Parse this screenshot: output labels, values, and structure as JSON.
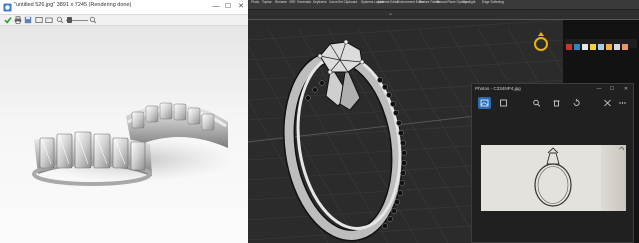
{
  "render_window": {
    "title": "\"untitled 526.jpg\" 3891 x 7245 (Rendering done)",
    "controls": {
      "minimize": "—",
      "maximize": "☐",
      "close": "✕"
    },
    "toolbar_icons": [
      "check-icon",
      "print-icon",
      "save-icon",
      "image-icon",
      "folder-icon",
      "zoom-out-icon",
      "zoom-slider",
      "zoom-in-icon"
    ]
  },
  "cad_app": {
    "ribbon_items": [
      "Photo",
      "Topbar",
      "Rename",
      "VRE",
      "Generator",
      "Keyframe",
      "Carve",
      "Set Clipboard",
      "Systems Layout",
      "Material Editor",
      "Environment Editor",
      "Texture Palette",
      "Ground Plane Options",
      "Spotlight",
      "Edge Softening"
    ],
    "collapse_glyph": "⌄"
  },
  "photos_window": {
    "title": "Photos - C334NP4.jpg",
    "controls": {
      "minimize": "—",
      "maximize": "☐",
      "close": "✕"
    },
    "toolbar_icons": [
      "image-icon",
      "crop-icon",
      "zoom-icon",
      "delete-icon",
      "rotate-icon",
      "edit-icon",
      "more-icon"
    ]
  },
  "colors": {
    "cad_background": "#2b2b2b",
    "grid_line": "#3c3c3c",
    "grid_axis": "#5a5a5a",
    "photos_accent": "#2b6cb3",
    "ring_gizmo": "#e8b400"
  }
}
